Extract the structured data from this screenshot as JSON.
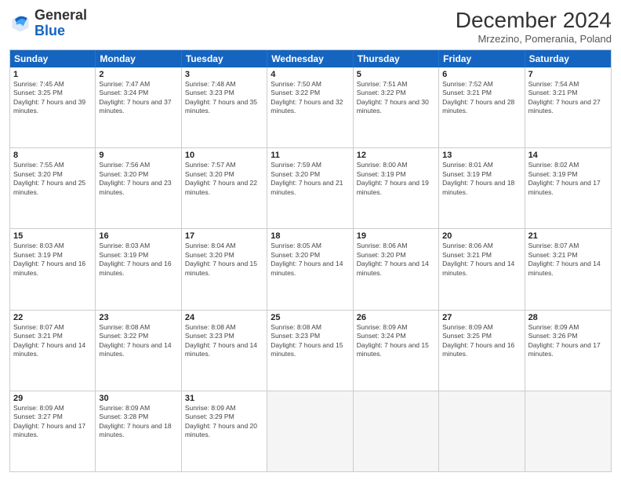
{
  "header": {
    "logo_general": "General",
    "logo_blue": "Blue",
    "month_title": "December 2024",
    "location": "Mrzezino, Pomerania, Poland"
  },
  "days_of_week": [
    "Sunday",
    "Monday",
    "Tuesday",
    "Wednesday",
    "Thursday",
    "Friday",
    "Saturday"
  ],
  "weeks": [
    [
      {
        "day": 1,
        "sunrise": "Sunrise: 7:45 AM",
        "sunset": "Sunset: 3:25 PM",
        "daylight": "Daylight: 7 hours and 39 minutes."
      },
      {
        "day": 2,
        "sunrise": "Sunrise: 7:47 AM",
        "sunset": "Sunset: 3:24 PM",
        "daylight": "Daylight: 7 hours and 37 minutes."
      },
      {
        "day": 3,
        "sunrise": "Sunrise: 7:48 AM",
        "sunset": "Sunset: 3:23 PM",
        "daylight": "Daylight: 7 hours and 35 minutes."
      },
      {
        "day": 4,
        "sunrise": "Sunrise: 7:50 AM",
        "sunset": "Sunset: 3:22 PM",
        "daylight": "Daylight: 7 hours and 32 minutes."
      },
      {
        "day": 5,
        "sunrise": "Sunrise: 7:51 AM",
        "sunset": "Sunset: 3:22 PM",
        "daylight": "Daylight: 7 hours and 30 minutes."
      },
      {
        "day": 6,
        "sunrise": "Sunrise: 7:52 AM",
        "sunset": "Sunset: 3:21 PM",
        "daylight": "Daylight: 7 hours and 28 minutes."
      },
      {
        "day": 7,
        "sunrise": "Sunrise: 7:54 AM",
        "sunset": "Sunset: 3:21 PM",
        "daylight": "Daylight: 7 hours and 27 minutes."
      }
    ],
    [
      {
        "day": 8,
        "sunrise": "Sunrise: 7:55 AM",
        "sunset": "Sunset: 3:20 PM",
        "daylight": "Daylight: 7 hours and 25 minutes."
      },
      {
        "day": 9,
        "sunrise": "Sunrise: 7:56 AM",
        "sunset": "Sunset: 3:20 PM",
        "daylight": "Daylight: 7 hours and 23 minutes."
      },
      {
        "day": 10,
        "sunrise": "Sunrise: 7:57 AM",
        "sunset": "Sunset: 3:20 PM",
        "daylight": "Daylight: 7 hours and 22 minutes."
      },
      {
        "day": 11,
        "sunrise": "Sunrise: 7:59 AM",
        "sunset": "Sunset: 3:20 PM",
        "daylight": "Daylight: 7 hours and 21 minutes."
      },
      {
        "day": 12,
        "sunrise": "Sunrise: 8:00 AM",
        "sunset": "Sunset: 3:19 PM",
        "daylight": "Daylight: 7 hours and 19 minutes."
      },
      {
        "day": 13,
        "sunrise": "Sunrise: 8:01 AM",
        "sunset": "Sunset: 3:19 PM",
        "daylight": "Daylight: 7 hours and 18 minutes."
      },
      {
        "day": 14,
        "sunrise": "Sunrise: 8:02 AM",
        "sunset": "Sunset: 3:19 PM",
        "daylight": "Daylight: 7 hours and 17 minutes."
      }
    ],
    [
      {
        "day": 15,
        "sunrise": "Sunrise: 8:03 AM",
        "sunset": "Sunset: 3:19 PM",
        "daylight": "Daylight: 7 hours and 16 minutes."
      },
      {
        "day": 16,
        "sunrise": "Sunrise: 8:03 AM",
        "sunset": "Sunset: 3:19 PM",
        "daylight": "Daylight: 7 hours and 16 minutes."
      },
      {
        "day": 17,
        "sunrise": "Sunrise: 8:04 AM",
        "sunset": "Sunset: 3:20 PM",
        "daylight": "Daylight: 7 hours and 15 minutes."
      },
      {
        "day": 18,
        "sunrise": "Sunrise: 8:05 AM",
        "sunset": "Sunset: 3:20 PM",
        "daylight": "Daylight: 7 hours and 14 minutes."
      },
      {
        "day": 19,
        "sunrise": "Sunrise: 8:06 AM",
        "sunset": "Sunset: 3:20 PM",
        "daylight": "Daylight: 7 hours and 14 minutes."
      },
      {
        "day": 20,
        "sunrise": "Sunrise: 8:06 AM",
        "sunset": "Sunset: 3:21 PM",
        "daylight": "Daylight: 7 hours and 14 minutes."
      },
      {
        "day": 21,
        "sunrise": "Sunrise: 8:07 AM",
        "sunset": "Sunset: 3:21 PM",
        "daylight": "Daylight: 7 hours and 14 minutes."
      }
    ],
    [
      {
        "day": 22,
        "sunrise": "Sunrise: 8:07 AM",
        "sunset": "Sunset: 3:21 PM",
        "daylight": "Daylight: 7 hours and 14 minutes."
      },
      {
        "day": 23,
        "sunrise": "Sunrise: 8:08 AM",
        "sunset": "Sunset: 3:22 PM",
        "daylight": "Daylight: 7 hours and 14 minutes."
      },
      {
        "day": 24,
        "sunrise": "Sunrise: 8:08 AM",
        "sunset": "Sunset: 3:23 PM",
        "daylight": "Daylight: 7 hours and 14 minutes."
      },
      {
        "day": 25,
        "sunrise": "Sunrise: 8:08 AM",
        "sunset": "Sunset: 3:23 PM",
        "daylight": "Daylight: 7 hours and 15 minutes."
      },
      {
        "day": 26,
        "sunrise": "Sunrise: 8:09 AM",
        "sunset": "Sunset: 3:24 PM",
        "daylight": "Daylight: 7 hours and 15 minutes."
      },
      {
        "day": 27,
        "sunrise": "Sunrise: 8:09 AM",
        "sunset": "Sunset: 3:25 PM",
        "daylight": "Daylight: 7 hours and 16 minutes."
      },
      {
        "day": 28,
        "sunrise": "Sunrise: 8:09 AM",
        "sunset": "Sunset: 3:26 PM",
        "daylight": "Daylight: 7 hours and 17 minutes."
      }
    ],
    [
      {
        "day": 29,
        "sunrise": "Sunrise: 8:09 AM",
        "sunset": "Sunset: 3:27 PM",
        "daylight": "Daylight: 7 hours and 17 minutes."
      },
      {
        "day": 30,
        "sunrise": "Sunrise: 8:09 AM",
        "sunset": "Sunset: 3:28 PM",
        "daylight": "Daylight: 7 hours and 18 minutes."
      },
      {
        "day": 31,
        "sunrise": "Sunrise: 8:09 AM",
        "sunset": "Sunset: 3:29 PM",
        "daylight": "Daylight: 7 hours and 20 minutes."
      },
      null,
      null,
      null,
      null
    ]
  ]
}
